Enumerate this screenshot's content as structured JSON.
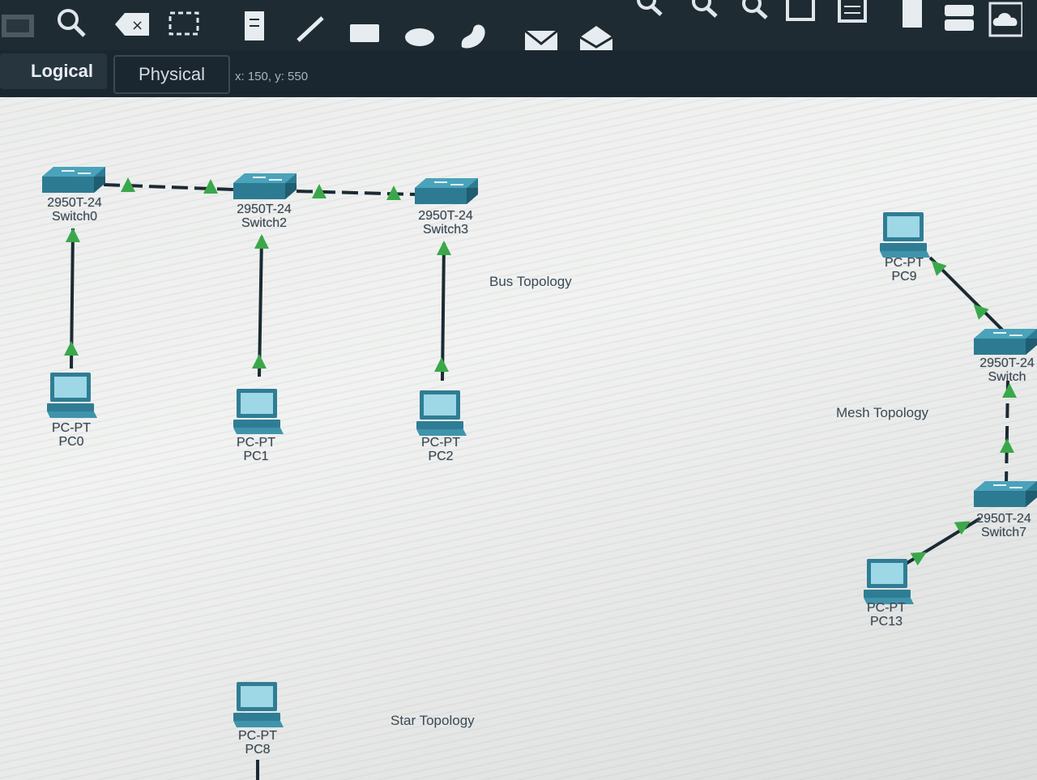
{
  "toolbar": {
    "icons": [
      "grid-select-icon",
      "zoom-icon",
      "delete-icon",
      "resize-icon",
      "note-icon",
      "line-draw-icon",
      "rectangle-icon",
      "ellipse-icon",
      "freeform-icon",
      "pdu-simple-icon",
      "pdu-complex-icon",
      "zoom-in-icon",
      "zoom-out-icon",
      "zoom-reset-icon",
      "palette-icon",
      "viewport-icon",
      "device-icon",
      "cluster-icon",
      "cloud-icon"
    ]
  },
  "tabs": {
    "logical": "Logical",
    "physical": "Physical",
    "coords": "x: 150, y: 550"
  },
  "devices": {
    "switch0": {
      "model": "2950T-24",
      "name": "Switch0"
    },
    "switch2": {
      "model": "2950T-24",
      "name": "Switch2"
    },
    "switch3": {
      "model": "2950T-24",
      "name": "Switch3"
    },
    "switch_mesh_top": {
      "model": "2950T-24",
      "name": "Switch"
    },
    "switch7": {
      "model": "2950T-24",
      "name": "Switch7"
    },
    "pc0": {
      "model": "PC-PT",
      "name": "PC0"
    },
    "pc1": {
      "model": "PC-PT",
      "name": "PC1"
    },
    "pc2": {
      "model": "PC-PT",
      "name": "PC2"
    },
    "pc9": {
      "model": "PC-PT",
      "name": "PC9"
    },
    "pc13": {
      "model": "PC-PT",
      "name": "PC13"
    },
    "pc8": {
      "model": "PC-PT",
      "name": "PC8"
    }
  },
  "labels": {
    "bus": "Bus Topology",
    "mesh": "Mesh Topology",
    "star": "Star Topology"
  },
  "colors": {
    "link_up": "#3aa84a",
    "cable": "#1b2a33",
    "switch": "#2f7d94",
    "pc_screen": "#8fd0e0"
  }
}
